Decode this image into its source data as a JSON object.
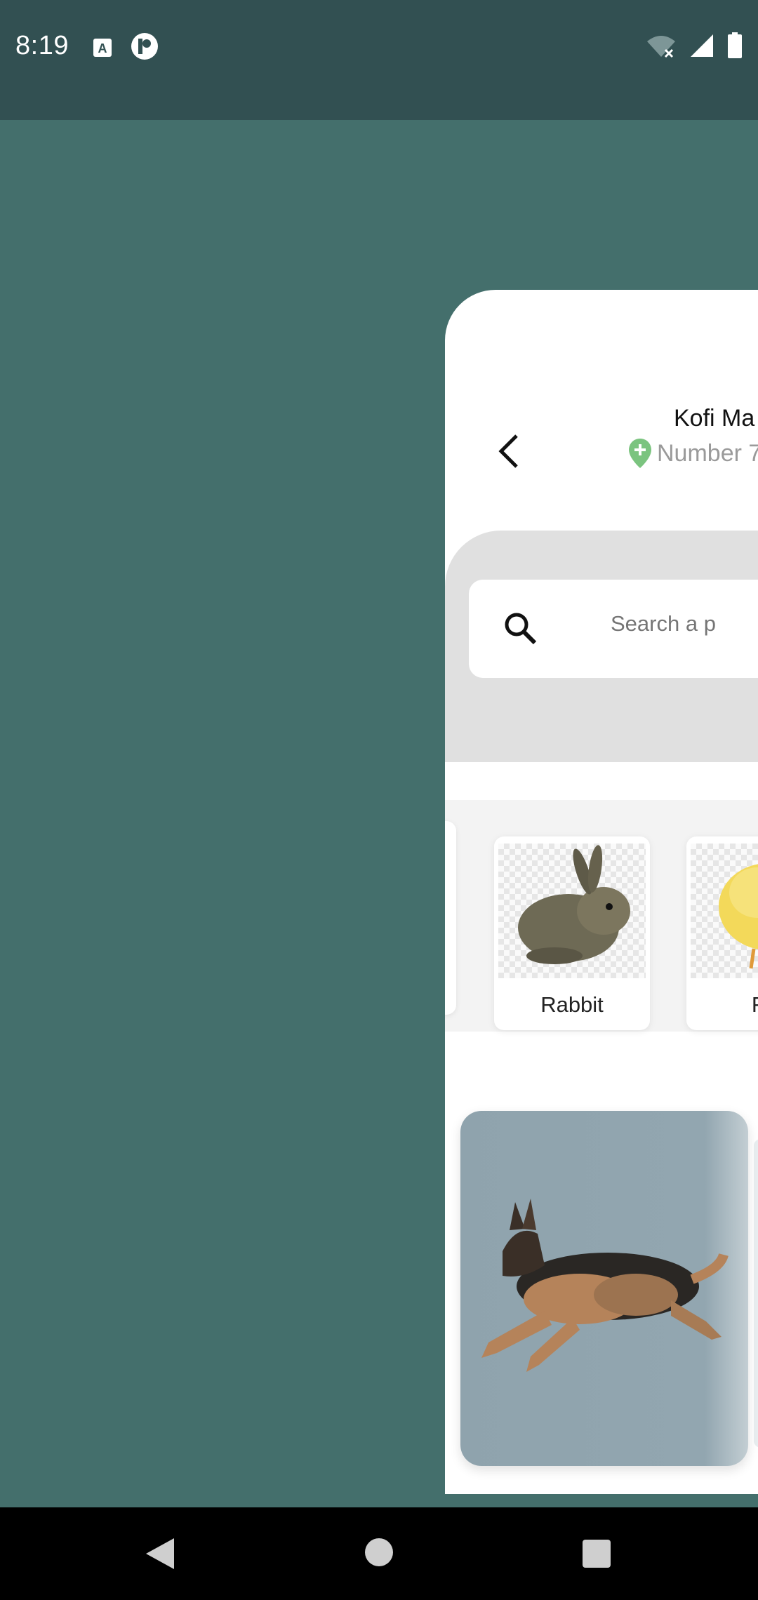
{
  "status_bar": {
    "time": "8:19",
    "icons": [
      "text-a-icon",
      "p-app-icon",
      "wifi-off-icon",
      "signal-icon",
      "battery-icon"
    ]
  },
  "header": {
    "user_name": "Kofi Ma",
    "location": "Number 7",
    "location_pin_color": "#7bc47f"
  },
  "search": {
    "placeholder": "Search a p"
  },
  "categories": [
    {
      "label": "Rabbit"
    },
    {
      "label": "Fo"
    }
  ],
  "feature": {
    "image": "german-shepherd-dog",
    "bg_color": "#8fa3ad"
  },
  "colors": {
    "background": "#446f6c",
    "status_bar": "#325052",
    "search_panel": "#e0e0e0"
  }
}
